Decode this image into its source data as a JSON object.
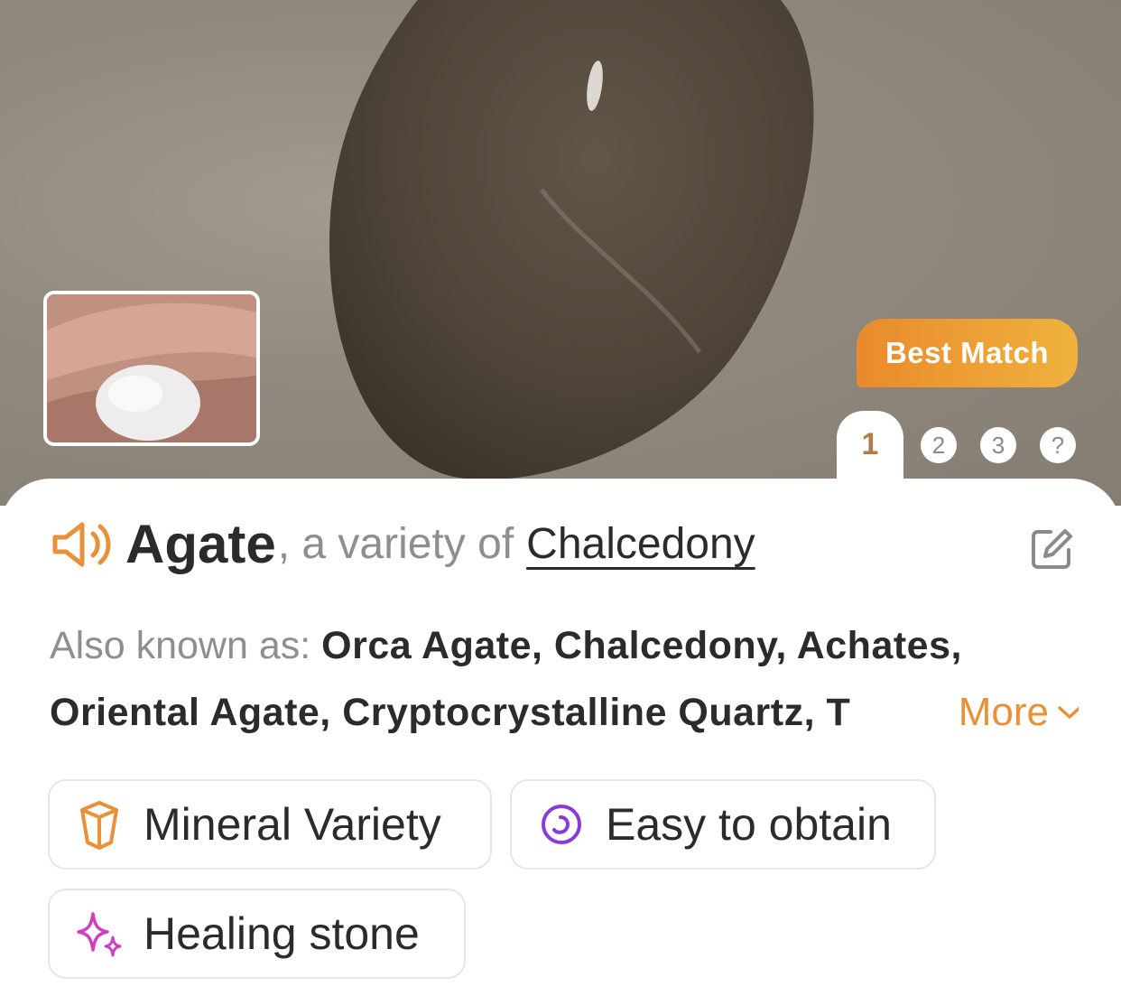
{
  "hero": {
    "badge_label": "Best Match",
    "tabs": [
      "1",
      "2",
      "3",
      "?"
    ],
    "active_tab": "1"
  },
  "result": {
    "name": "Agate",
    "variety_prefix": ", a variety of",
    "variety_name": "Chalcedony"
  },
  "aliases": {
    "label": "Also known as:",
    "line1": "Orca Agate, Chalcedony, Achates,",
    "line2": "Oriental Agate, Cryptocrystalline Quartz, T",
    "more_label": "More"
  },
  "tags": [
    {
      "label": "Mineral Variety",
      "icon": "crystal-icon",
      "color": "#e8903a"
    },
    {
      "label": "Easy to obtain",
      "icon": "obtain-circle-icon",
      "color": "#8a3ad6"
    },
    {
      "label": "Healing stone",
      "icon": "sparkle-icon",
      "color": "#d13fc1"
    }
  ],
  "colors": {
    "accent": "#e8903a",
    "badge_gradient": [
      "#e98a2c",
      "#f0b23d"
    ],
    "active_tab": "#b27b47"
  }
}
